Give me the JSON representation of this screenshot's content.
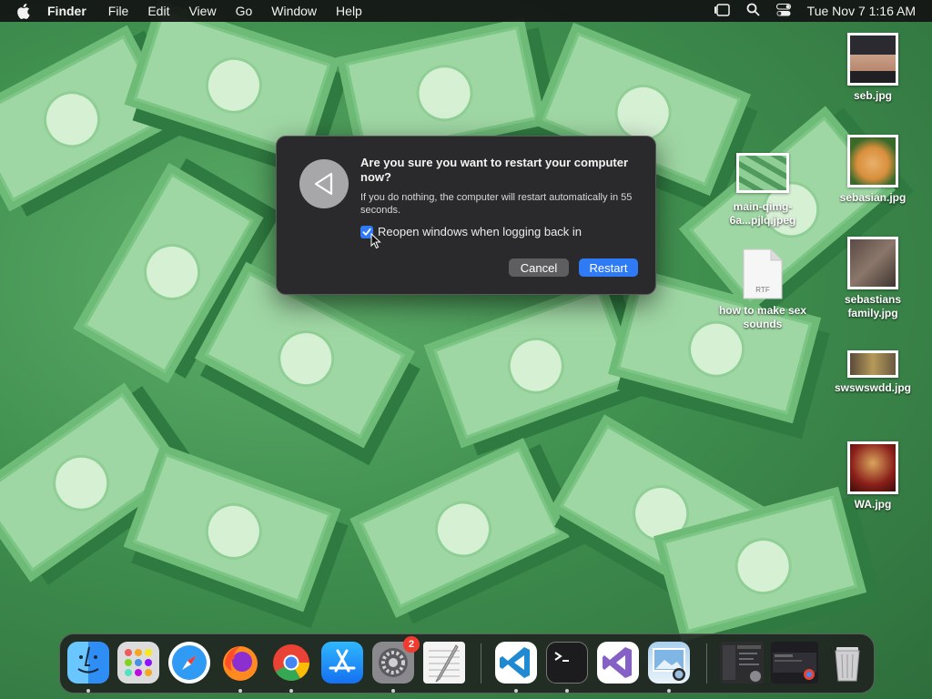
{
  "menubar": {
    "app_name": "Finder",
    "items": [
      "File",
      "Edit",
      "View",
      "Go",
      "Window",
      "Help"
    ],
    "clock": "Tue Nov 7  1:16 AM"
  },
  "dialog": {
    "title": "Are you sure you want to restart your computer now?",
    "message": "If you do nothing, the computer will restart automatically in 55 seconds.",
    "checkbox_label": "Reopen windows when logging back in",
    "checkbox_checked": true,
    "cancel_label": "Cancel",
    "restart_label": "Restart",
    "accent_color": "#2f7bf5"
  },
  "desktop": {
    "icons": [
      {
        "label": "seb.jpg"
      },
      {
        "label": "sebasian.jpg"
      },
      {
        "label": "sebastians family.jpg"
      },
      {
        "label": "swswswdd.jpg"
      },
      {
        "label": "WA.jpg"
      },
      {
        "label": "main-qimg-6a...pjlq.jpeg"
      },
      {
        "label": "how to make sex sounds",
        "badge": "RTF"
      }
    ]
  },
  "dock": {
    "apps": [
      "Finder",
      "Launchpad",
      "Safari",
      "Firefox",
      "Chrome",
      "App Store",
      "System Settings",
      "TextEdit",
      "Visual Studio Code",
      "Terminal",
      "Visual Studio",
      "Preview"
    ],
    "settings_badge": "2",
    "trash": "Trash"
  }
}
